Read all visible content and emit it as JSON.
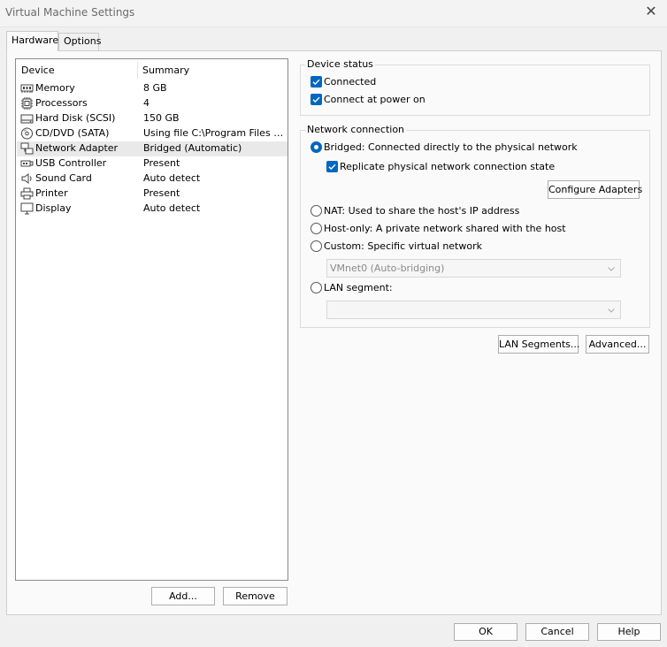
{
  "window": {
    "title": "Virtual Machine Settings",
    "close_glyph": "✕"
  },
  "tabs": [
    {
      "label": "Hardware",
      "active": true
    },
    {
      "label": "Options",
      "active": false
    }
  ],
  "device_list": {
    "col_device": "Device",
    "col_summary": "Summary",
    "rows": [
      {
        "icon": "memory-icon",
        "name": "Memory",
        "summary": "8 GB",
        "selected": false
      },
      {
        "icon": "processor-icon",
        "name": "Processors",
        "summary": "4",
        "selected": false
      },
      {
        "icon": "hard-disk-icon",
        "name": "Hard Disk (SCSI)",
        "summary": "150 GB",
        "selected": false
      },
      {
        "icon": "cd-dvd-icon",
        "name": "CD/DVD (SATA)",
        "summary": "Using file C:\\Program Files (x8...",
        "selected": false
      },
      {
        "icon": "network-adapter-icon",
        "name": "Network Adapter",
        "summary": "Bridged (Automatic)",
        "selected": true
      },
      {
        "icon": "usb-icon",
        "name": "USB Controller",
        "summary": "Present",
        "selected": false
      },
      {
        "icon": "sound-card-icon",
        "name": "Sound Card",
        "summary": "Auto detect",
        "selected": false
      },
      {
        "icon": "printer-icon",
        "name": "Printer",
        "summary": "Present",
        "selected": false
      },
      {
        "icon": "display-icon",
        "name": "Display",
        "summary": "Auto detect",
        "selected": false
      }
    ],
    "add_button": "Add...",
    "remove_button": "Remove"
  },
  "device_status": {
    "label": "Device status",
    "connected": {
      "label": "Connected",
      "checked": true
    },
    "connect_at_power_on": {
      "label": "Connect at power on",
      "checked": true
    }
  },
  "network_connection": {
    "label": "Network connection",
    "bridged": {
      "label": "Bridged: Connected directly to the physical network",
      "selected": true
    },
    "replicate": {
      "label": "Replicate physical network connection state",
      "checked": true
    },
    "configure_adapters": "Configure Adapters",
    "nat": {
      "label": "NAT: Used to share the host's IP address",
      "selected": false
    },
    "host_only": {
      "label": "Host-only: A private network shared with the host",
      "selected": false
    },
    "custom": {
      "label": "Custom: Specific virtual network",
      "selected": false
    },
    "custom_combo_value": "VMnet0 (Auto-bridging)",
    "lan_segment": {
      "label": "LAN segment:",
      "selected": false
    },
    "lan_combo_value": ""
  },
  "lan_segments_button": "LAN Segments...",
  "advanced_button": "Advanced...",
  "footer": {
    "ok": "OK",
    "cancel": "Cancel",
    "help": "Help"
  },
  "colors": {
    "accent": "#0067c0",
    "selection": "#e9e9e9",
    "disabled_text": "#8a8a8a"
  }
}
